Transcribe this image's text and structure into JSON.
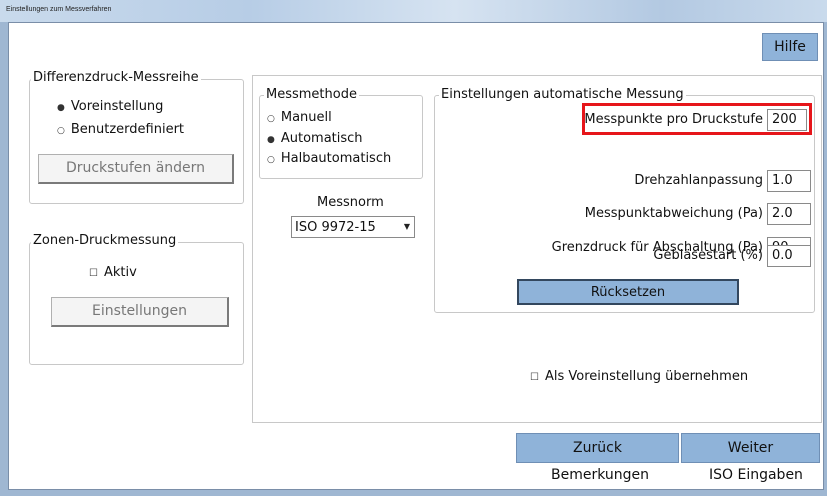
{
  "window": {
    "title": "Einstellungen zum Messverfahren"
  },
  "help_button": "Hilfe",
  "differenzdruck": {
    "title": "Differenzdruck-Messreihe",
    "options": [
      "Voreinstellung",
      "Benutzerdefiniert"
    ],
    "selected": "Voreinstellung",
    "button": "Druckstufen ändern"
  },
  "zonen": {
    "title": "Zonen-Druckmessung",
    "checkbox": "Aktiv",
    "button": "Einstellungen"
  },
  "messmethode": {
    "title": "Messmethode",
    "options": [
      "Manuell",
      "Automatisch",
      "Halbautomatisch"
    ],
    "selected": "Automatisch"
  },
  "messnorm": {
    "label": "Messnorm",
    "value": "ISO 9972-15"
  },
  "auto": {
    "title": "Einstellungen automatische Messung",
    "fields": [
      {
        "label": "Messpunkte pro Druckstufe",
        "value": "200"
      },
      {
        "label": "Drehzahlanpassung",
        "value": "1.0"
      },
      {
        "label": "Messpunktabweichung (Pa)",
        "value": "2.0"
      },
      {
        "label": "Grenzdruck für Abschaltung (Pa)",
        "value": "90"
      },
      {
        "label": "Gebläsestart (%)",
        "value": "0.0"
      }
    ],
    "reset_button": "Rücksetzen"
  },
  "save_default": "Als Voreinstellung übernehmen",
  "nav": {
    "back": "Zurück",
    "next": "Weiter",
    "remarks": "Bemerkungen",
    "iso": "ISO Eingaben"
  }
}
